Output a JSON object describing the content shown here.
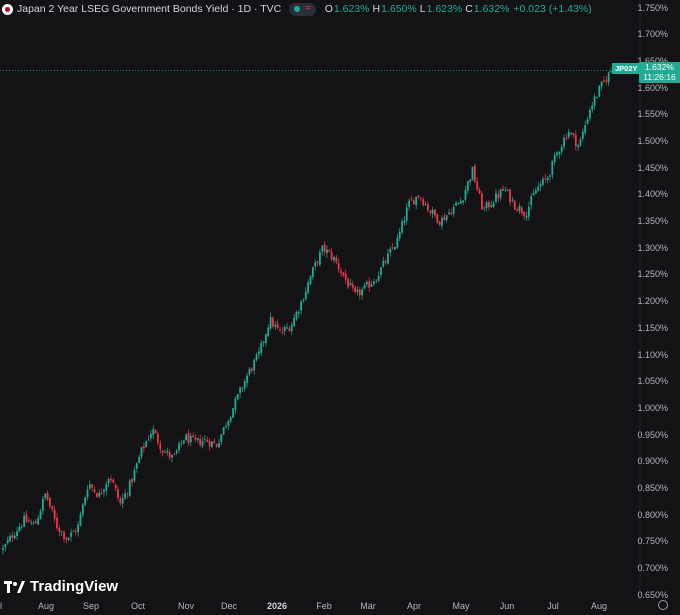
{
  "legend": {
    "title": "Japan 2 Year LSEG Government Bonds Yield · 1D · TVC",
    "status_symbol": "≈",
    "open_label": "O",
    "open_value": "1.623%",
    "high_label": "H",
    "high_value": "1.650%",
    "low_label": "L",
    "low_value": "1.623%",
    "close_label": "C",
    "close_value": "1.632%",
    "change": "+0.023 (+1.43%)"
  },
  "price_tag": {
    "symbol": "JP02Y",
    "value": "1.632%",
    "countdown": "11:26:16"
  },
  "brand": "TradingView",
  "colors": {
    "up": "#22ab94",
    "down": "#f23645",
    "background": "#131316",
    "price_line": "#22ab94"
  },
  "chart_data": {
    "type": "candlestick",
    "title": "Japan 2 Year LSEG Government Bonds Yield · 1D · TVC",
    "ylim": [
      0.64,
      1.755
    ],
    "y_ticks": [
      "1.750%",
      "1.700%",
      "1.650%",
      "1.600%",
      "1.550%",
      "1.500%",
      "1.450%",
      "1.400%",
      "1.350%",
      "1.300%",
      "1.250%",
      "1.200%",
      "1.150%",
      "1.100%",
      "1.050%",
      "1.000%",
      "0.950%",
      "0.900%",
      "0.850%",
      "0.800%",
      "0.750%",
      "0.700%",
      "0.650%"
    ],
    "x_ticks": [
      "l",
      "Aug",
      "Sep",
      "Oct",
      "Nov",
      "Dec",
      "2026",
      "Feb",
      "Mar",
      "Apr",
      "May",
      "Jun",
      "Jul",
      "Aug"
    ],
    "last_value": 1.632,
    "trend_points": [
      [
        "l",
        0.735
      ],
      [
        "l",
        0.765
      ],
      [
        "l",
        0.79
      ],
      [
        "l",
        0.78
      ],
      [
        "Aug",
        0.84
      ],
      [
        "Aug",
        0.78
      ],
      [
        "Aug",
        0.755
      ],
      [
        "Aug",
        0.775
      ],
      [
        "Sep",
        0.86
      ],
      [
        "Sep",
        0.835
      ],
      [
        "Sep",
        0.875
      ],
      [
        "Sep",
        0.82
      ],
      [
        "Sep",
        0.86
      ],
      [
        "Oct",
        0.92
      ],
      [
        "Oct",
        0.96
      ],
      [
        "Oct",
        0.92
      ],
      [
        "Oct",
        0.905
      ],
      [
        "Nov",
        0.945
      ],
      [
        "Nov",
        0.935
      ],
      [
        "Nov",
        0.94
      ],
      [
        "Nov",
        0.93
      ],
      [
        "Dec",
        0.975
      ],
      [
        "Dec",
        1.02
      ],
      [
        "Dec",
        1.065
      ],
      [
        "Dec",
        1.1
      ],
      [
        "Dec",
        1.165
      ],
      [
        "2026",
        1.14
      ],
      [
        "2026",
        1.155
      ],
      [
        "2026",
        1.2
      ],
      [
        "2026",
        1.255
      ],
      [
        "Feb",
        1.3
      ],
      [
        "Feb",
        1.28
      ],
      [
        "Feb",
        1.245
      ],
      [
        "Mar",
        1.21
      ],
      [
        "Mar",
        1.225
      ],
      [
        "Mar",
        1.245
      ],
      [
        "Mar",
        1.28
      ],
      [
        "Apr",
        1.315
      ],
      [
        "Apr",
        1.38
      ],
      [
        "Apr",
        1.4
      ],
      [
        "Apr",
        1.37
      ],
      [
        "May",
        1.35
      ],
      [
        "May",
        1.37
      ],
      [
        "May",
        1.39
      ],
      [
        "May",
        1.445
      ],
      [
        "Jun",
        1.37
      ],
      [
        "Jun",
        1.39
      ],
      [
        "Jun",
        1.41
      ],
      [
        "Jun",
        1.38
      ],
      [
        "Jul",
        1.365
      ],
      [
        "Jul",
        1.41
      ],
      [
        "Jul",
        1.43
      ],
      [
        "Jul",
        1.48
      ],
      [
        "Jul",
        1.52
      ],
      [
        "Jul",
        1.49
      ],
      [
        "Aug",
        1.56
      ],
      [
        "Aug",
        1.6
      ],
      [
        "Aug",
        1.632
      ]
    ]
  }
}
